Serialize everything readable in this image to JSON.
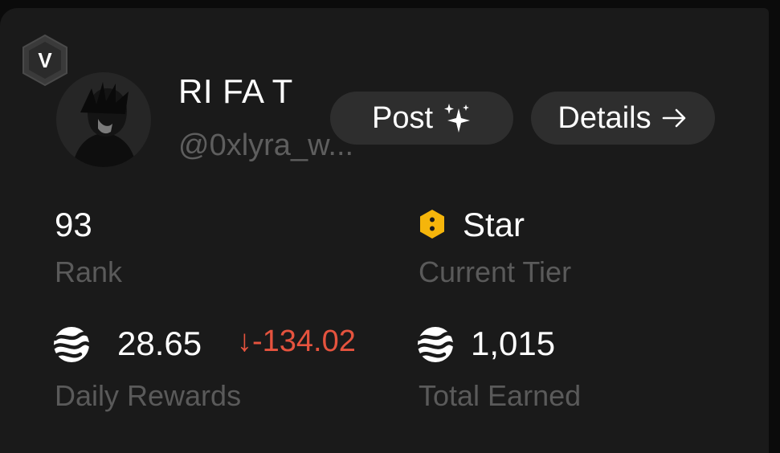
{
  "profile": {
    "badge_letter": "V",
    "display_name": "RI FA T",
    "handle": "@0xlyra_w..."
  },
  "actions": {
    "post_label": "Post",
    "post_icon": "sparkle-icon",
    "details_label": "Details",
    "details_icon": "arrow-right-icon"
  },
  "stats": {
    "rank": {
      "value": "93",
      "label": "Rank"
    },
    "tier": {
      "value": "Star",
      "label": "Current Tier",
      "icon": "tier-hexagon-icon",
      "color": "#f5b50b"
    },
    "daily": {
      "value": "28.65",
      "change": "-134.02",
      "change_arrow": "↓",
      "label": "Daily Rewards",
      "icon": "coin-icon",
      "change_color": "#e5533e"
    },
    "total": {
      "value": "1,015",
      "label": "Total Earned",
      "icon": "coin-icon"
    }
  },
  "colors": {
    "card_bg": "#1a1a1a",
    "page_bg": "#0b0b0b",
    "pill_bg": "#2e2e2e",
    "muted_text": "#5a5a5a"
  }
}
